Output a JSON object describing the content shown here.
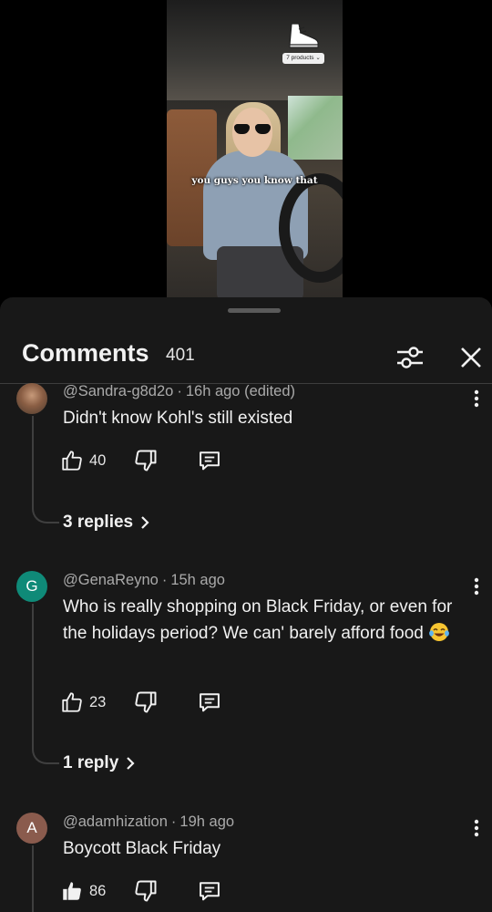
{
  "video": {
    "caption": "you guys you know that",
    "products_label": "7 products"
  },
  "comments_panel": {
    "title": "Comments",
    "count": "401"
  },
  "comments": [
    {
      "handle": "@Sandra-g8d2o",
      "time": "16h ago (edited)",
      "text": "Didn't know Kohl's still existed",
      "likes": "40",
      "replies_label": "3 replies"
    },
    {
      "avatar_letter": "G",
      "handle": "@GenaReyno",
      "time": "15h ago",
      "text": "Who is really shopping on Black Friday, or even for the holidays period? We can' barely afford food",
      "emoji": "joy-emoji",
      "likes": "23",
      "replies_label": "1 reply"
    },
    {
      "avatar_letter": "A",
      "handle": "@adamhization",
      "time": "19h ago",
      "text": "Boycott Black Friday",
      "likes": "86"
    }
  ],
  "colors": {
    "sheet_bg": "#181818",
    "text_primary": "#f1f1f1",
    "text_secondary": "#aaaaaa",
    "avatar_g": "#0f8a78",
    "avatar_a": "#8a5b4d"
  }
}
